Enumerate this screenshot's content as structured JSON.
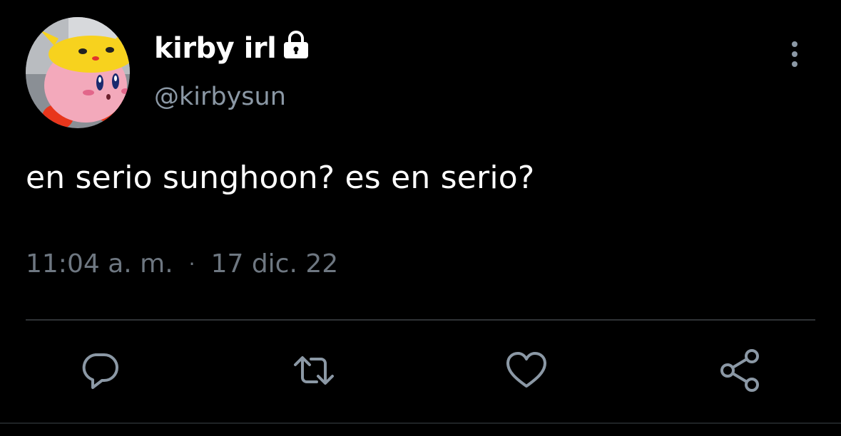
{
  "tweet": {
    "display_name": "kirby irl",
    "handle": "@kirbysun",
    "text": "en serio sunghoon? es en serio?",
    "time": "11:04 a. m.",
    "separator": "·",
    "date": "17 dic. 22",
    "protected_icon": "lock-icon"
  },
  "actions": [
    {
      "name": "reply",
      "icon": "reply-icon"
    },
    {
      "name": "retweet",
      "icon": "retweet-icon"
    },
    {
      "name": "like",
      "icon": "heart-icon"
    },
    {
      "name": "share",
      "icon": "share-icon"
    }
  ],
  "colors": {
    "background": "#000000",
    "primary_text": "#ffffff",
    "secondary_text": "#8b98a5",
    "icon": "#8b98a5",
    "divider": "#2f3336"
  }
}
